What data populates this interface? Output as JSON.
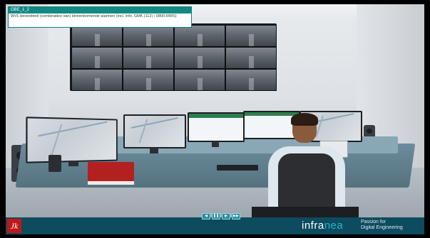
{
  "overlay": {
    "id_label": "OBE_1_2",
    "description": "WVL beoordeelt (combinaties van) binnenkomende alarmen (incl. info. GMK (112) / 0800-RWS)"
  },
  "footer": {
    "brand_prefix": "infra",
    "brand_suffix": "nea",
    "tagline_line1": "Passion for",
    "tagline_line2": "Digital Engineering",
    "left_logo_glyph": "Jk",
    "controls": [
      {
        "icon": "previous-icon",
        "glyph": "◀"
      },
      {
        "icon": "pause-icon",
        "glyph": "❚❚"
      },
      {
        "icon": "play-icon",
        "glyph": "▶"
      },
      {
        "icon": "next-icon",
        "glyph": "▶▶"
      }
    ]
  },
  "colors": {
    "accent": "#118a84",
    "footer_bg": "#0d4b5e",
    "brand_accent": "#1fb7c9",
    "logo_red": "#c01717"
  }
}
